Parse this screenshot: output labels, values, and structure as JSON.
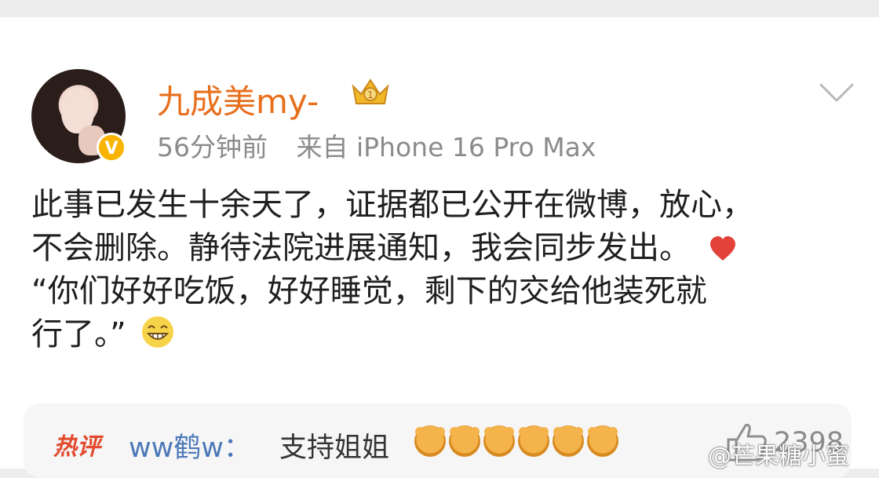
{
  "post": {
    "author": "九成美my-",
    "verified_badge": "V",
    "time": "56分钟前",
    "source": "来自 iPhone 16 Pro Max",
    "lines": [
      "此事已发生十余天了，证据都已公开在微博，放心，",
      "不会删除。静待法院进展通知，我会同步发出。",
      "“你们好好吃饭，好好睡觉，剩下的交给他装死就",
      "行了。”"
    ]
  },
  "hot_comment": {
    "tag": "热评",
    "user": "ww鹤w：",
    "text": "支持姐姐",
    "emoji_count": 6,
    "likes": "2398"
  },
  "watermark": "@芒果糖小蜜",
  "icons": [
    "crown-icon",
    "chevron-down-icon",
    "heart-icon",
    "grin-icon",
    "thumb-up-icon",
    "bear-emoji-icon"
  ],
  "colors": {
    "author": "#e86f1c",
    "meta": "#8b8b8b",
    "comment_user": "#4c78b8",
    "hot_tag": "#e34a2e"
  }
}
